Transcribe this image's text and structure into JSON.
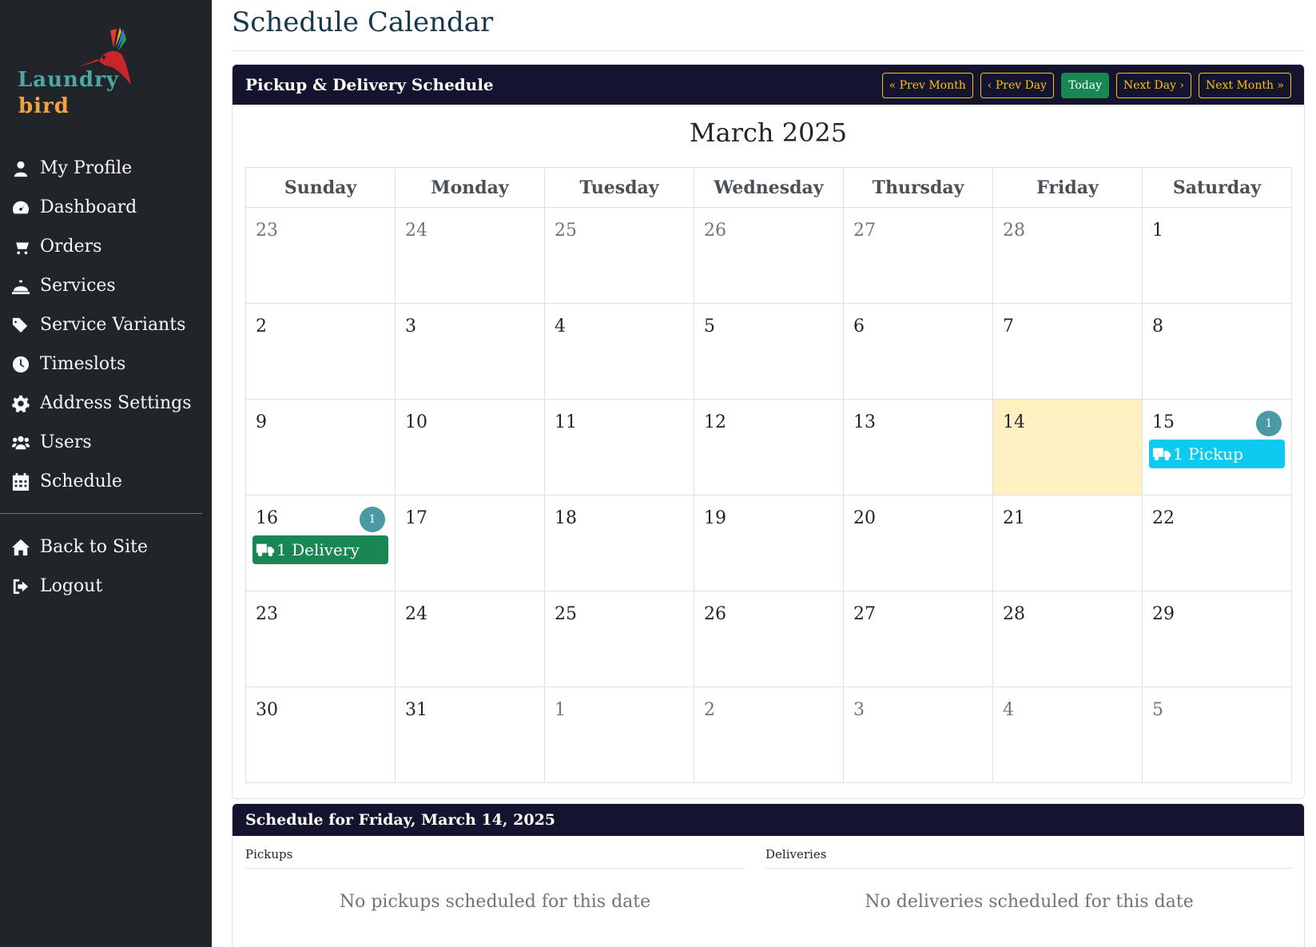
{
  "brand": {
    "line1": "Laundry",
    "line2": "bird"
  },
  "sidebar": {
    "items": [
      {
        "label": "My Profile",
        "icon": "user-icon"
      },
      {
        "label": "Dashboard",
        "icon": "gauge-icon"
      },
      {
        "label": "Orders",
        "icon": "cart-icon"
      },
      {
        "label": "Services",
        "icon": "bell-icon"
      },
      {
        "label": "Service Variants",
        "icon": "tags-icon"
      },
      {
        "label": "Timeslots",
        "icon": "clock-icon"
      },
      {
        "label": "Address Settings",
        "icon": "gear-icon"
      },
      {
        "label": "Users",
        "icon": "users-icon"
      },
      {
        "label": "Schedule",
        "icon": "calendar-icon"
      }
    ],
    "bottom": [
      {
        "label": "Back to Site",
        "icon": "home-icon"
      },
      {
        "label": "Logout",
        "icon": "logout-icon"
      }
    ]
  },
  "page": {
    "title": "Schedule Calendar"
  },
  "calendar_card": {
    "header": "Pickup & Delivery Schedule",
    "buttons": {
      "prev_month": "Prev Month",
      "prev_day": "Prev Day",
      "today": "Today",
      "next_day": "Next Day",
      "next_month": "Next Month"
    },
    "month_title": "March 2025",
    "weekdays": [
      "Sunday",
      "Monday",
      "Tuesday",
      "Wednesday",
      "Thursday",
      "Friday",
      "Saturday"
    ],
    "weeks": [
      [
        {
          "d": "23",
          "other": true
        },
        {
          "d": "24",
          "other": true
        },
        {
          "d": "25",
          "other": true
        },
        {
          "d": "26",
          "other": true
        },
        {
          "d": "27",
          "other": true
        },
        {
          "d": "28",
          "other": true
        },
        {
          "d": "1"
        }
      ],
      [
        {
          "d": "2"
        },
        {
          "d": "3"
        },
        {
          "d": "4"
        },
        {
          "d": "5"
        },
        {
          "d": "6"
        },
        {
          "d": "7"
        },
        {
          "d": "8"
        }
      ],
      [
        {
          "d": "9"
        },
        {
          "d": "10"
        },
        {
          "d": "11"
        },
        {
          "d": "12"
        },
        {
          "d": "13"
        },
        {
          "d": "14",
          "today": true
        },
        {
          "d": "15",
          "badge": "1",
          "event": {
            "type": "pickup",
            "label": "1 Pickup"
          }
        }
      ],
      [
        {
          "d": "16",
          "badge": "1",
          "event": {
            "type": "delivery",
            "label": "1 Delivery"
          }
        },
        {
          "d": "17"
        },
        {
          "d": "18"
        },
        {
          "d": "19"
        },
        {
          "d": "20"
        },
        {
          "d": "21"
        },
        {
          "d": "22"
        }
      ],
      [
        {
          "d": "23"
        },
        {
          "d": "24"
        },
        {
          "d": "25"
        },
        {
          "d": "26"
        },
        {
          "d": "27"
        },
        {
          "d": "28"
        },
        {
          "d": "29"
        }
      ],
      [
        {
          "d": "30"
        },
        {
          "d": "31"
        },
        {
          "d": "1",
          "other": true
        },
        {
          "d": "2",
          "other": true
        },
        {
          "d": "3",
          "other": true
        },
        {
          "d": "4",
          "other": true
        },
        {
          "d": "5",
          "other": true
        }
      ]
    ]
  },
  "schedule_card": {
    "header": "Schedule for Friday, March 14, 2025",
    "pickups_label": "Pickups",
    "deliveries_label": "Deliveries",
    "no_pickups": "No pickups scheduled for this date",
    "no_deliveries": "No deliveries scheduled for this date"
  },
  "colors": {
    "sidebar_bg": "#212529",
    "header_bg": "#14142f",
    "warning": "#ffc107",
    "success": "#198754",
    "info": "#0dcaf0",
    "today_bg": "#fff0c2",
    "badge": "#4a9aa3"
  }
}
